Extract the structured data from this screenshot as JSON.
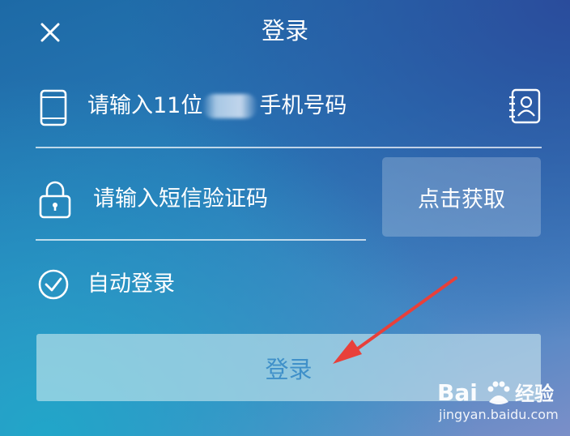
{
  "header": {
    "title": "登录",
    "close_icon": "close-icon"
  },
  "phone": {
    "icon": "phone-icon",
    "placeholder_prefix": "请输入11位",
    "placeholder_suffix": "手机号码",
    "contacts_icon": "contacts-icon"
  },
  "code": {
    "icon": "lock-icon",
    "placeholder": "请输入短信验证码",
    "get_code_label": "点击获取"
  },
  "auto_login": {
    "icon": "check-circle-icon",
    "label": "自动登录",
    "checked": true
  },
  "login_button": {
    "label": "登录"
  },
  "annotation": {
    "arrow_icon": "red-arrow-icon",
    "arrow_color": "#e8403a"
  },
  "watermark": {
    "logo_text": "Bai  经验",
    "site": "jingyan.baidu.com"
  },
  "colors": {
    "login_text": "#3f90c9",
    "accent_bg": "#2a79b8"
  }
}
